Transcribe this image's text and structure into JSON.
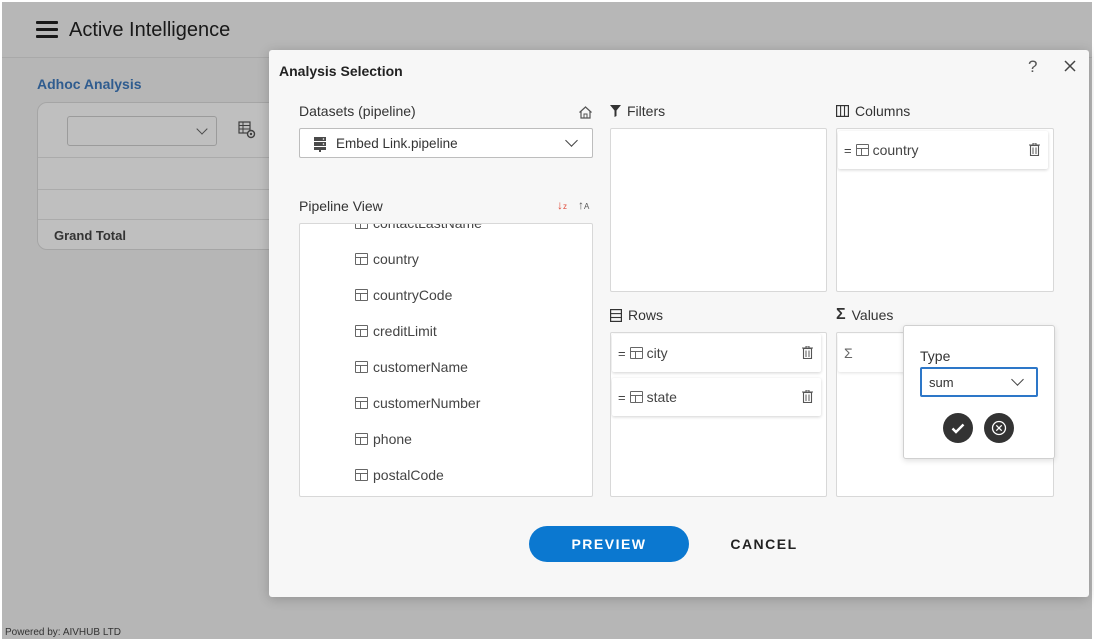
{
  "app": {
    "title": "Active Intelligence",
    "breadcrumb": "Adhoc Analysis",
    "grand_total_label": "Grand Total",
    "powered_by": "Powered by: AIVHUB LTD"
  },
  "dialog": {
    "title": "Analysis Selection",
    "help_label": "?",
    "datasets_label": "Datasets (pipeline)",
    "selected_dataset": "Embed Link.pipeline",
    "pipeline_view_label": "Pipeline View",
    "pipeline_items": [
      "contactLastName",
      "country",
      "countryCode",
      "creditLimit",
      "customerName",
      "customerNumber",
      "phone",
      "postalCode"
    ],
    "filters_label": "Filters",
    "columns_label": "Columns",
    "columns": [
      "country"
    ],
    "rows_label": "Rows",
    "rows": [
      "city",
      "state"
    ],
    "values_label": "Values",
    "values_placeholder_symbol": "Σ",
    "type_popover": {
      "label": "Type",
      "selected": "sum"
    },
    "preview_label": "PREVIEW",
    "cancel_label": "CANCEL"
  }
}
